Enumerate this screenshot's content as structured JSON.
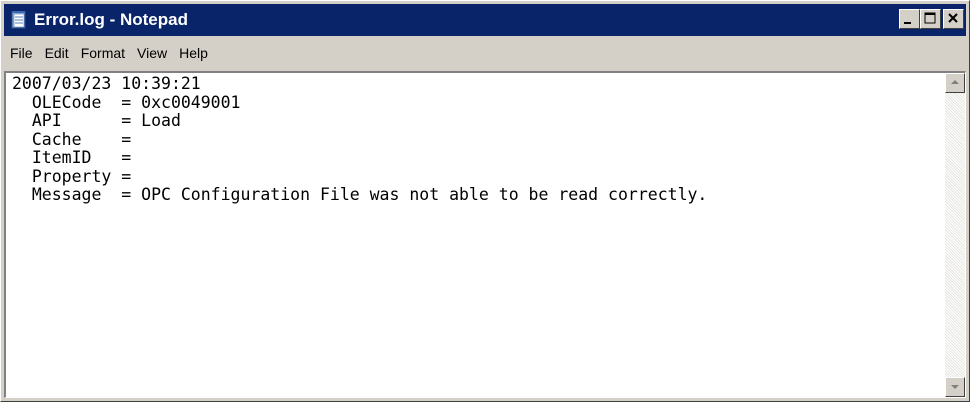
{
  "window": {
    "title": "Error.log - Notepad",
    "title_bar_color": "#0a246a",
    "app_icon": "notepad-icon"
  },
  "caption_buttons": {
    "minimize_icon": "minimize-icon",
    "maximize_icon": "maximize-icon",
    "close_icon": "close-icon"
  },
  "menu": {
    "items": [
      "File",
      "Edit",
      "Format",
      "View",
      "Help"
    ]
  },
  "document": {
    "lines": [
      "2007/03/23 10:39:21",
      "  OLECode  = 0xc0049001",
      "  API      = Load",
      "  Cache    =",
      "  ItemID   =",
      "  Property =",
      "  Message  = OPC Configuration File was not able to be read correctly."
    ]
  },
  "scrollbar": {
    "up_icon": "scroll-up-arrow-icon",
    "down_icon": "scroll-down-arrow-icon"
  }
}
